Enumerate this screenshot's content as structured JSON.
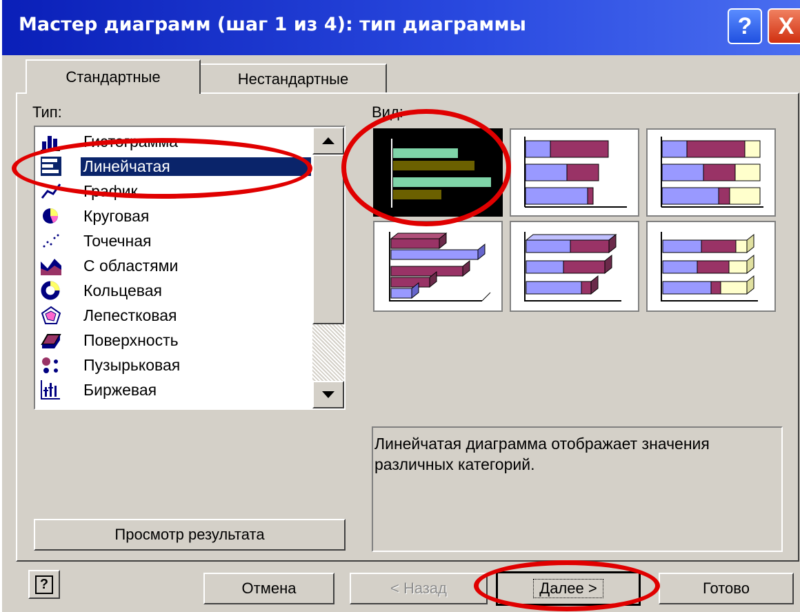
{
  "window": {
    "title": "Мастер диаграмм (шаг 1 из 4): тип диаграммы",
    "help_symbol": "?",
    "close_symbol": "X"
  },
  "tabs": [
    {
      "label": "Стандартные",
      "active": true
    },
    {
      "label": "Нестандартные",
      "active": false
    }
  ],
  "type_label": "Тип:",
  "view_label": "Вид:",
  "chart_types": [
    {
      "label": "Гистограмма",
      "icon": "column-chart-icon"
    },
    {
      "label": "Линейчатая",
      "icon": "bar-chart-icon",
      "selected": true
    },
    {
      "label": "График",
      "icon": "line-chart-icon"
    },
    {
      "label": "Круговая",
      "icon": "pie-chart-icon"
    },
    {
      "label": "Точечная",
      "icon": "scatter-chart-icon"
    },
    {
      "label": "С областями",
      "icon": "area-chart-icon"
    },
    {
      "label": "Кольцевая",
      "icon": "doughnut-chart-icon"
    },
    {
      "label": "Лепестковая",
      "icon": "radar-chart-icon"
    },
    {
      "label": "Поверхность",
      "icon": "surface-chart-icon"
    },
    {
      "label": "Пузырьковая",
      "icon": "bubble-chart-icon"
    },
    {
      "label": "Биржевая",
      "icon": "stock-chart-icon"
    }
  ],
  "description": "Линейчатая диаграмма отображает значения различных категорий.",
  "buttons": {
    "preview": "Просмотр результата",
    "cancel": "Отмена",
    "back": "< Назад",
    "next": "Далее >",
    "finish": "Готово",
    "help": "?"
  },
  "colors": {
    "bar_green": "#7fd4a8",
    "bar_olive": "#6b6000",
    "series_blue": "#9999ff",
    "series_maroon": "#993366",
    "series_yellow": "#ffffcc",
    "highlight": "#e00000"
  }
}
